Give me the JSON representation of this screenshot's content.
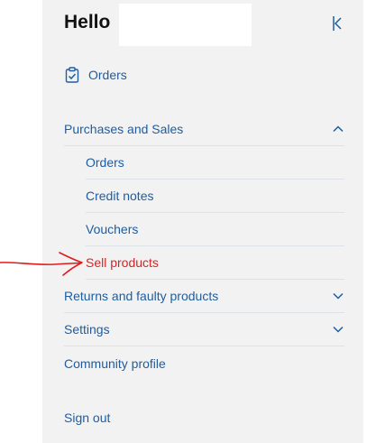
{
  "header": {
    "greeting": "Hello",
    "close_icon": "collapse-panel-icon"
  },
  "top_link": {
    "label": "Orders",
    "icon": "clipboard-check-icon"
  },
  "menu": {
    "purchases": {
      "label": "Purchases and Sales",
      "expanded": true,
      "items": [
        {
          "label": "Orders"
        },
        {
          "label": "Credit notes"
        },
        {
          "label": "Vouchers"
        },
        {
          "label": "Sell products",
          "highlighted": true
        }
      ]
    },
    "returns": {
      "label": "Returns and faulty products",
      "expanded": false
    },
    "settings": {
      "label": "Settings",
      "expanded": false
    },
    "community": {
      "label": "Community profile"
    }
  },
  "footer": {
    "sign_out": "Sign out"
  },
  "colors": {
    "link": "#1f5da0",
    "highlight": "#d42525",
    "panel_bg": "#f2f2f2"
  }
}
